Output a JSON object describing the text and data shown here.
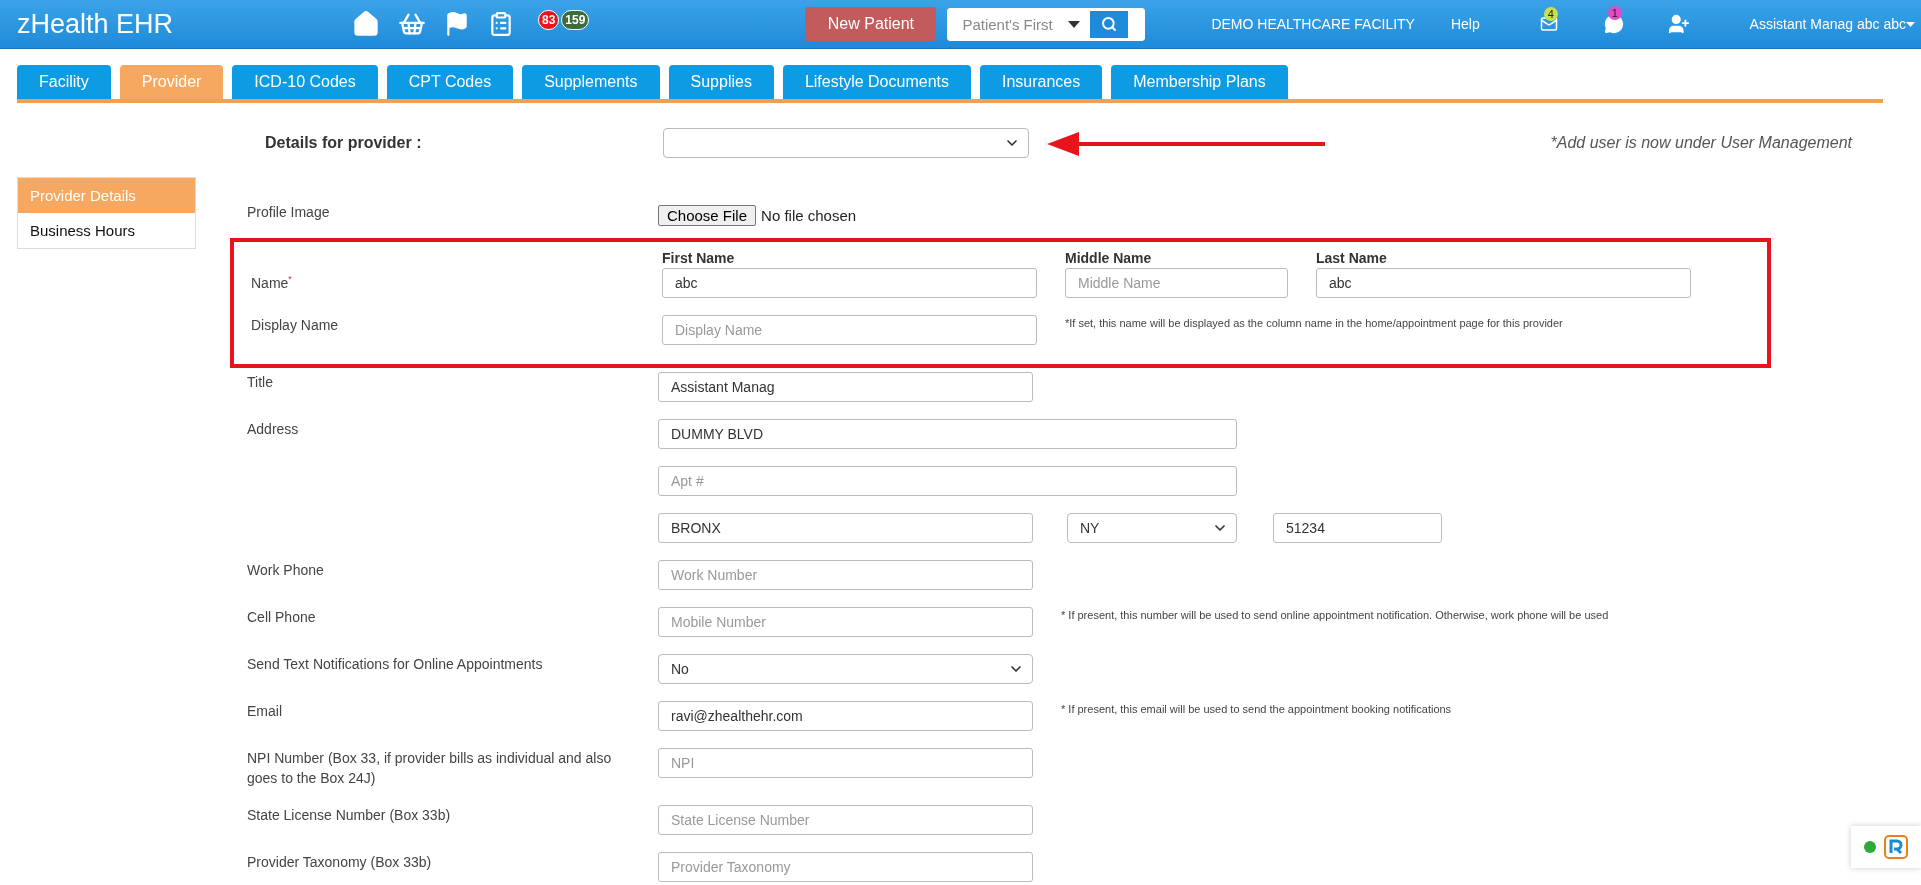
{
  "header": {
    "title": "zHealth EHR",
    "badges": [
      {
        "text": "83",
        "color": "#e8141b"
      },
      {
        "text": "159",
        "color": "#3d6b3d"
      }
    ],
    "new_patient": "New Patient",
    "search": {
      "placeholder": "Patient's First"
    },
    "facility": "DEMO HEALTHCARE FACILITY",
    "help": "Help",
    "mail_count": {
      "text": "4",
      "color": "#c8e04a"
    },
    "chat_count": {
      "text": "1",
      "color": "#e04cc6"
    },
    "user": "Assistant Manag abc abc"
  },
  "tabs": [
    {
      "label": "Facility",
      "selected": false
    },
    {
      "label": "Provider",
      "selected": true
    },
    {
      "label": "ICD-10 Codes",
      "selected": false
    },
    {
      "label": "CPT Codes",
      "selected": false
    },
    {
      "label": "Supplements",
      "selected": false
    },
    {
      "label": "Supplies",
      "selected": false
    },
    {
      "label": "Lifestyle Documents",
      "selected": false
    },
    {
      "label": "Insurances",
      "selected": false
    },
    {
      "label": "Membership Plans",
      "selected": false
    }
  ],
  "details": {
    "label": "Details for provider :",
    "note": "*Add user is now under User Management"
  },
  "sidebar": {
    "items": [
      {
        "label": "Provider Details",
        "selected": true
      },
      {
        "label": "Business Hours",
        "selected": false
      }
    ]
  },
  "form": {
    "before": [
      {
        "kind": "file",
        "label": "Profile Image",
        "button": "Choose File",
        "status": "No file chosen"
      }
    ],
    "highlighted": [
      {
        "kind": "name",
        "label": "Name",
        "required": true,
        "required_mark": "*",
        "parts": [
          {
            "heading": "First Name",
            "value": "abc"
          },
          {
            "heading": "Middle Name",
            "placeholder": "Middle Name"
          },
          {
            "heading": "Last Name",
            "value": "abc"
          }
        ]
      },
      {
        "kind": "text",
        "label": "Display Name",
        "placeholder": "Display Name",
        "hint": "*If set, this name will be displayed as the column name in the home/appointment page for this provider"
      }
    ],
    "rows": [
      {
        "kind": "text",
        "label": "Title",
        "value": "Assistant Manag"
      },
      {
        "kind": "address",
        "label": "Address",
        "street": "DUMMY BLVD",
        "apt": {
          "placeholder": "Apt #"
        },
        "city": "BRONX",
        "state": "NY",
        "zip": "51234"
      },
      {
        "kind": "text",
        "label": "Work Phone",
        "placeholder": "Work Number"
      },
      {
        "kind": "text",
        "label": "Cell Phone",
        "placeholder": "Mobile Number",
        "hint": "* If present, this number will be used to send online appointment notification. Otherwise, work phone will be used"
      },
      {
        "kind": "select",
        "label": "Send Text Notifications for Online Appointments",
        "value": "No"
      },
      {
        "kind": "text",
        "label": "Email",
        "value": "ravi@zhealthehr.com",
        "hint": "* If present, this email will be used to send the appointment booking notifications"
      },
      {
        "kind": "text",
        "label": "NPI Number (Box 33, if provider bills as individual and also goes to the Box 24J)",
        "placeholder": "NPI"
      },
      {
        "kind": "text",
        "label": "State License Number (Box 33b)",
        "placeholder": "State License Number"
      },
      {
        "kind": "text",
        "label": "Provider Taxonomy (Box 33b)",
        "placeholder": "Provider Taxonomy"
      }
    ]
  }
}
